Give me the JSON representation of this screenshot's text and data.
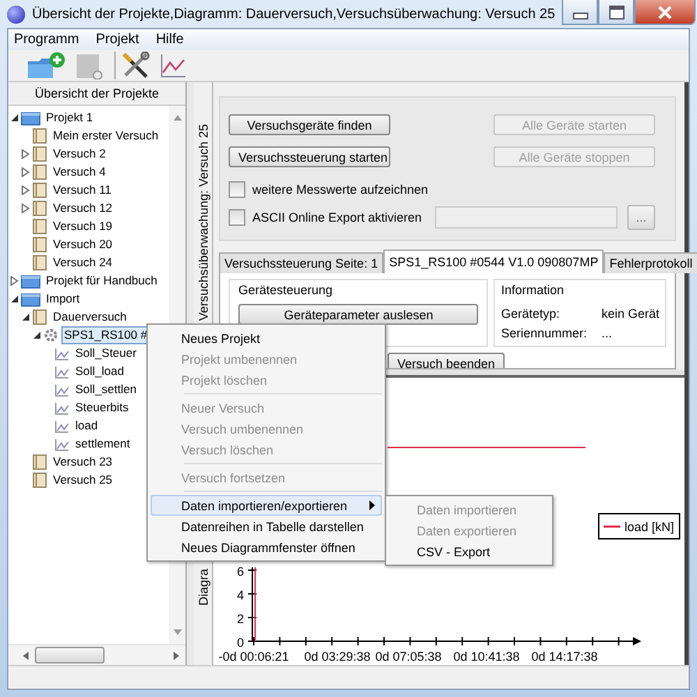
{
  "window": {
    "title": "Übersicht der Projekte,Diagramm: Dauerversuch,Versuchsüberwachung: Versuch 25"
  },
  "menu_bar": [
    "Programm",
    "Projekt",
    "Hilfe"
  ],
  "toolbar": [
    {
      "kind": "new-project"
    },
    {
      "kind": "blank"
    },
    {
      "kind": "tools"
    },
    {
      "kind": "chart"
    }
  ],
  "project_panel": {
    "title": "Übersicht der Projekte",
    "tree": [
      {
        "kind": "project",
        "label": "Projekt 1",
        "expanded": true,
        "selected": false,
        "children": [
          {
            "kind": "test",
            "label": "Mein erster Versuch",
            "selected": false
          },
          {
            "kind": "test",
            "label": "Versuch 2",
            "expanded": false,
            "selected": false
          },
          {
            "kind": "test",
            "label": "Versuch 4",
            "expanded": false,
            "selected": false
          },
          {
            "kind": "test",
            "label": "Versuch 11",
            "expanded": false,
            "selected": false
          },
          {
            "kind": "test",
            "label": "Versuch 12",
            "expanded": false,
            "selected": false
          },
          {
            "kind": "test",
            "label": "Versuch 19",
            "selected": false
          },
          {
            "kind": "test",
            "label": "Versuch 20",
            "selected": false
          },
          {
            "kind": "test",
            "label": "Versuch 24",
            "selected": false
          }
        ]
      },
      {
        "kind": "project",
        "label": "Projekt für Handbuch",
        "expanded": false,
        "selected": false
      },
      {
        "kind": "project",
        "label": "Import",
        "expanded": true,
        "selected": false,
        "children": [
          {
            "kind": "test",
            "label": "Dauerversuch",
            "expanded": true,
            "selected": false,
            "children": [
              {
                "kind": "device",
                "label": "SPS1_RS100 #",
                "expanded": true,
                "selected": true,
                "children": [
                  {
                    "kind": "series",
                    "label": "Soll_Steuer",
                    "selected": false
                  },
                  {
                    "kind": "series",
                    "label": "Soll_load",
                    "selected": false
                  },
                  {
                    "kind": "series",
                    "label": "Soll_settlen",
                    "selected": false
                  },
                  {
                    "kind": "series",
                    "label": "Steuerbits",
                    "selected": false
                  },
                  {
                    "kind": "series",
                    "label": "load",
                    "selected": false
                  },
                  {
                    "kind": "series",
                    "label": "settlement",
                    "selected": false
                  }
                ]
              }
            ]
          },
          {
            "kind": "test",
            "label": "Versuch 23",
            "selected": false
          },
          {
            "kind": "test",
            "label": "Versuch 25",
            "selected": false
          }
        ]
      }
    ]
  },
  "monitor_panel": {
    "side_label": "Versuchsüberwachung: Versuch 25",
    "buttons": [
      {
        "label": "Versuchsgeräte finden",
        "disabled": false
      },
      {
        "label": "Alle Geräte starten",
        "disabled": true
      },
      {
        "label": "Versuchssteuerung starten",
        "disabled": false
      },
      {
        "label": "Alle Geräte stoppen",
        "disabled": true
      }
    ],
    "checkboxes": [
      {
        "label": "weitere Messwerte aufzeichnen",
        "checked": false
      },
      {
        "label": "ASCII Online Export aktivieren",
        "checked": false
      }
    ],
    "browse_button": "...",
    "tabs": [
      {
        "label": "Versuchssteuerung Seite: 1",
        "selected": false
      },
      {
        "label": "SPS1_RS100 #0544 V1.0 090807MP",
        "selected": true
      },
      {
        "label": "Fehlerprotokoll",
        "selected": false
      }
    ],
    "device_control": {
      "title": "Gerätesteuerung",
      "button": "Geräteparameter auslesen"
    },
    "end_button": "Versuch beenden",
    "information": {
      "title": "Information",
      "rows": [
        {
          "label": "Gerätetyp:",
          "value": "kein Gerät"
        },
        {
          "label": "Seriennummer:",
          "value": "..."
        }
      ]
    }
  },
  "diagram_panel": {
    "side_label": "Diagra",
    "y_ticks": [
      "6",
      "4",
      "2",
      "0"
    ],
    "x_ticks": [
      "-0d 00:06:21",
      "0d 03:29:38",
      "0d 07:05:38",
      "0d 10:41:38",
      "0d 14:17:38"
    ],
    "legend": [
      {
        "label": "load [kN]",
        "color": "#e0304a"
      }
    ]
  },
  "context_menu": [
    {
      "kind": "item",
      "label": "Neues Projekt",
      "disabled": false,
      "selected": false
    },
    {
      "kind": "item",
      "label": "Projekt umbenennen",
      "disabled": true,
      "selected": false
    },
    {
      "kind": "item",
      "label": "Projekt löschen",
      "disabled": true,
      "selected": false
    },
    {
      "kind": "separator"
    },
    {
      "kind": "item",
      "label": "Neuer Versuch",
      "disabled": true,
      "selected": false
    },
    {
      "kind": "item",
      "label": "Versuch umbenennen",
      "disabled": true,
      "selected": false
    },
    {
      "kind": "item",
      "label": "Versuch löschen",
      "disabled": true,
      "selected": false
    },
    {
      "kind": "separator"
    },
    {
      "kind": "item",
      "label": "Versuch fortsetzen",
      "disabled": true,
      "selected": false
    },
    {
      "kind": "separator"
    },
    {
      "kind": "submenu",
      "label": "Daten importieren/exportieren",
      "disabled": false,
      "selected": true
    },
    {
      "kind": "item",
      "label": "Datenreihen in Tabelle darstellen",
      "disabled": false,
      "selected": false
    },
    {
      "kind": "item",
      "label": "Neues Diagrammfenster öffnen",
      "disabled": false,
      "selected": false
    }
  ],
  "submenu": [
    {
      "label": "Daten importieren",
      "disabled": true
    },
    {
      "label": "Daten exportieren",
      "disabled": true
    },
    {
      "label": "CSV - Export",
      "disabled": false
    }
  ]
}
